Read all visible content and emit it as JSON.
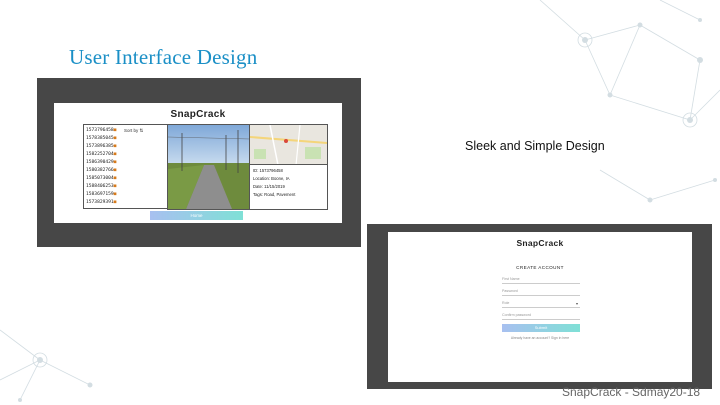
{
  "slide": {
    "title": "User Interface Design",
    "caption": "Sleek and Simple Design",
    "footer": "SnapCrack - Sdmay20-18"
  },
  "screenshot1": {
    "app_logo": "SnapCrack",
    "sort_label": "Sort by ⇅",
    "image_list": [
      "1573796458",
      "1578385045",
      "1573896385",
      "1582252704",
      "1586390429",
      "1580382766",
      "1585073004",
      "1588406253",
      "1583697159",
      "1573829391"
    ],
    "metadata": {
      "id": "ID: 1573796458",
      "location": "Location: Boone, IA",
      "date": "Date: 11/15/2019",
      "tags": "Tags: Road, Pavement"
    },
    "home_button": "Home"
  },
  "screenshot2": {
    "app_logo": "SnapCrack",
    "heading": "CREATE ACCOUNT",
    "fields": [
      "First Name",
      "Password",
      "Role",
      "Confirm password"
    ],
    "submit_button": "Submit",
    "signin_text": "Already have an account? Sign in here"
  },
  "colors": {
    "title": "#1a8fc6",
    "frame": "#474747",
    "accent_gradient_start": "#a8c0f0",
    "accent_gradient_end": "#7fe0d6"
  }
}
